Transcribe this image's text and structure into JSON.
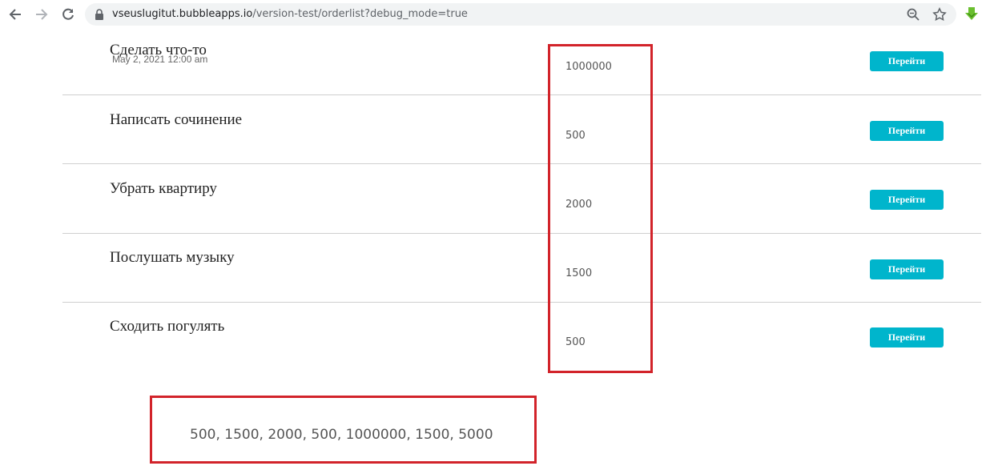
{
  "browser": {
    "url_host": "vseuslugitut.bubbleapps.io",
    "url_path": "/version-test/orderlist?debug_mode=true",
    "icons": [
      "back-arrow-icon",
      "forward-arrow-icon",
      "reload-icon",
      "lock-icon",
      "zoom-icon",
      "star-icon",
      "download-extension-icon"
    ]
  },
  "orders": [
    {
      "title": "Сделать что-то",
      "date": "May 2, 2021 12:00 am",
      "amount": "1000000",
      "button": "Перейти"
    },
    {
      "title": "Написать сочинение",
      "date": "",
      "amount": "500",
      "button": "Перейти"
    },
    {
      "title": "Убрать квартиру",
      "date": "",
      "amount": "2000",
      "button": "Перейти"
    },
    {
      "title": "Послушать музыку",
      "date": "",
      "amount": "1500",
      "button": "Перейти"
    },
    {
      "title": "Сходить погулять",
      "date": "",
      "amount": "500",
      "button": "Перейти"
    }
  ],
  "summary_text": "500, 1500, 2000, 500, 1000000, 1500, 5000",
  "colors": {
    "accent": "#00b5cc",
    "highlight": "#d2232a",
    "divider": "#cfcfcf"
  }
}
